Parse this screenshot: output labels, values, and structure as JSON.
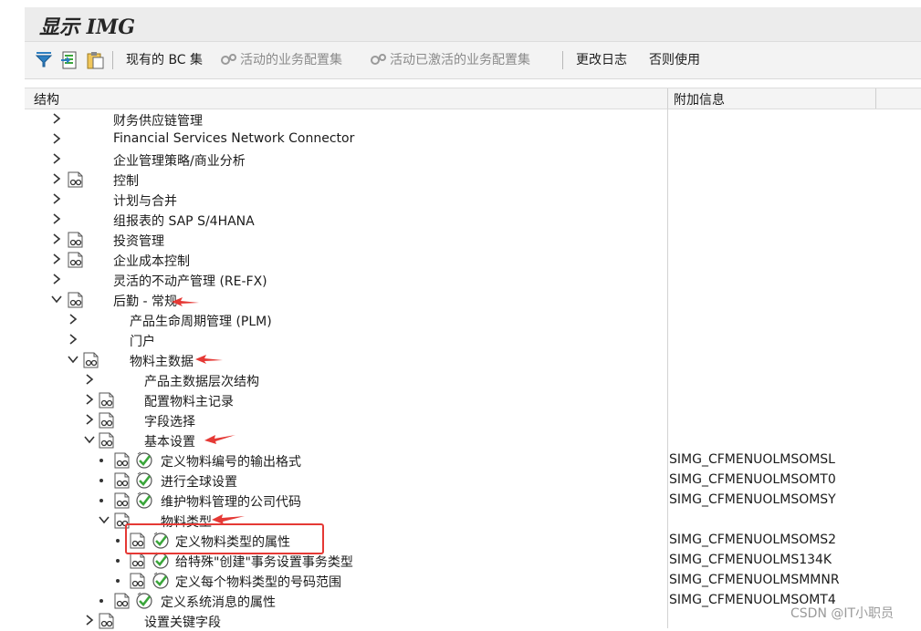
{
  "window": {
    "title": "显示 IMG"
  },
  "toolbar": {
    "current_bc_set": "现有的 BC 集",
    "active_business_config_sets": "活动的业务配置集",
    "active_activated_business_config_sets": "活动已激活的业务配置集",
    "change_log": "更改日志",
    "usage": "否则使用"
  },
  "columns": {
    "structure": "结构",
    "additional_info": "附加信息"
  },
  "tree": [
    {
      "label": "财务供应链管理",
      "info": ""
    },
    {
      "label": "Financial Services Network Connector",
      "info": ""
    },
    {
      "label": "企业管理策略/商业分析",
      "info": ""
    },
    {
      "label": "控制",
      "info": ""
    },
    {
      "label": "计划与合并",
      "info": ""
    },
    {
      "label": "组报表的 SAP S/4HANA",
      "info": ""
    },
    {
      "label": "投资管理",
      "info": ""
    },
    {
      "label": "企业成本控制",
      "info": ""
    },
    {
      "label": "灵活的不动产管理 (RE-FX)",
      "info": ""
    },
    {
      "label": "后勤 - 常规",
      "info": ""
    },
    {
      "label": "产品生命周期管理 (PLM)",
      "info": ""
    },
    {
      "label": "门户",
      "info": ""
    },
    {
      "label": "物料主数据",
      "info": ""
    },
    {
      "label": "产品主数据层次结构",
      "info": ""
    },
    {
      "label": "配置物料主记录",
      "info": ""
    },
    {
      "label": "字段选择",
      "info": ""
    },
    {
      "label": "基本设置",
      "info": ""
    },
    {
      "label": "定义物料编号的输出格式",
      "info": "SIMG_CFMENUOLMSOMSL"
    },
    {
      "label": "进行全球设置",
      "info": "SIMG_CFMENUOLMSOMT0"
    },
    {
      "label": "维护物料管理的公司代码",
      "info": "SIMG_CFMENUOLMSOMSY"
    },
    {
      "label": "物料类型",
      "info": ""
    },
    {
      "label": "定义物料类型的属性",
      "info": "SIMG_CFMENUOLMSOMS2"
    },
    {
      "label": "给特殊\"创建\"事务设置事务类型",
      "info": "SIMG_CFMENUOLMS134K"
    },
    {
      "label": "定义每个物料类型的号码范围",
      "info": "SIMG_CFMENUOLMSMMNR"
    },
    {
      "label": "定义系统消息的属性",
      "info": "SIMG_CFMENUOLMSOMT4"
    },
    {
      "label": "设置关键字段",
      "info": ""
    }
  ],
  "watermark": "CSDN @IT小职员",
  "colors": {
    "highlight": "#e53935",
    "activity_green": "#3aa63a",
    "nav_blue": "#2b6cb3"
  }
}
